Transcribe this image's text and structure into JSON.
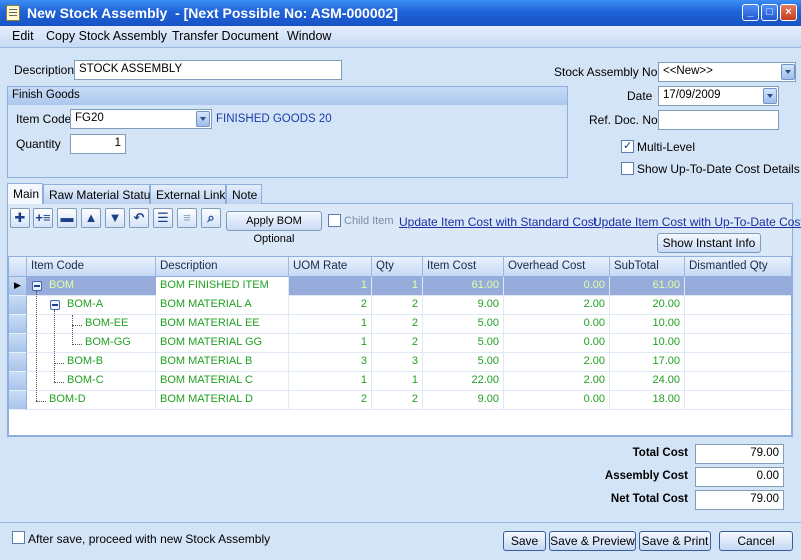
{
  "window": {
    "title": "New Stock Assembly  - [Next Possible No: ASM-000002]"
  },
  "menu": [
    "Edit",
    "Copy Stock Assembly",
    "Transfer Document",
    "Window"
  ],
  "form": {
    "description_label": "Description",
    "description_value": "STOCK ASSEMBLY",
    "finish_goods_title": "Finish Goods",
    "item_code_label": "Item Code",
    "item_code_value": "FG20",
    "item_code_desc": "FINISHED GOODS 20",
    "quantity_label": "Quantity",
    "quantity_value": "1",
    "stock_assembly_no_label": "Stock Assembly No",
    "stock_assembly_no_value": "<<New>>",
    "date_label": "Date",
    "date_value": "17/09/2009",
    "ref_doc_label": "Ref. Doc. No",
    "ref_doc_value": "",
    "multi_level_label": "Multi-Level",
    "multi_level_checked": true,
    "show_uptodate_label": "Show Up-To-Date Cost Details",
    "show_uptodate_checked": false
  },
  "tabs": [
    "Main",
    "Raw Material Status",
    "External Link",
    "Note"
  ],
  "toolbar": {
    "apply_bom_label": "Apply BOM Optional",
    "child_item_label": "Child Item",
    "update_std_link": "Update Item Cost with Standard Cost",
    "update_uptodate_link": "Update Item Cost with Up-To-Date Cost",
    "show_instant_info": "Show Instant Info"
  },
  "grid": {
    "columns": [
      "Item Code",
      "Description",
      "UOM Rate",
      "Qty",
      "Item Cost",
      "Overhead Cost",
      "SubTotal",
      "Dismantled Qty"
    ],
    "rows": [
      {
        "code": "BOM",
        "desc": "BOM FINISHED ITEM",
        "uom": "1",
        "qty": "1",
        "cost": "61.00",
        "overhead": "0.00",
        "subtotal": "61.00",
        "dismantled": ""
      },
      {
        "code": "BOM-A",
        "desc": "BOM MATERIAL A",
        "uom": "2",
        "qty": "2",
        "cost": "9.00",
        "overhead": "2.00",
        "subtotal": "20.00",
        "dismantled": ""
      },
      {
        "code": "BOM-EE",
        "desc": "BOM MATERIAL EE",
        "uom": "1",
        "qty": "2",
        "cost": "5.00",
        "overhead": "0.00",
        "subtotal": "10.00",
        "dismantled": ""
      },
      {
        "code": "BOM-GG",
        "desc": "BOM MATERIAL GG",
        "uom": "1",
        "qty": "2",
        "cost": "5.00",
        "overhead": "0.00",
        "subtotal": "10.00",
        "dismantled": ""
      },
      {
        "code": "BOM-B",
        "desc": "BOM MATERIAL B",
        "uom": "3",
        "qty": "3",
        "cost": "5.00",
        "overhead": "2.00",
        "subtotal": "17.00",
        "dismantled": ""
      },
      {
        "code": "BOM-C",
        "desc": "BOM MATERIAL C",
        "uom": "1",
        "qty": "1",
        "cost": "22.00",
        "overhead": "2.00",
        "subtotal": "24.00",
        "dismantled": ""
      },
      {
        "code": "BOM-D",
        "desc": "BOM MATERIAL D",
        "uom": "2",
        "qty": "2",
        "cost": "9.00",
        "overhead": "0.00",
        "subtotal": "18.00",
        "dismantled": ""
      }
    ]
  },
  "totals": {
    "total_cost_label": "Total Cost",
    "total_cost_value": "79.00",
    "assembly_cost_label": "Assembly Cost",
    "assembly_cost_value": "0.00",
    "net_total_label": "Net Total Cost",
    "net_total_value": "79.00"
  },
  "footer": {
    "after_save_label": "After save, proceed with new Stock Assembly",
    "save": "Save",
    "save_preview": "Save & Preview",
    "save_print": "Save & Print",
    "cancel": "Cancel"
  }
}
